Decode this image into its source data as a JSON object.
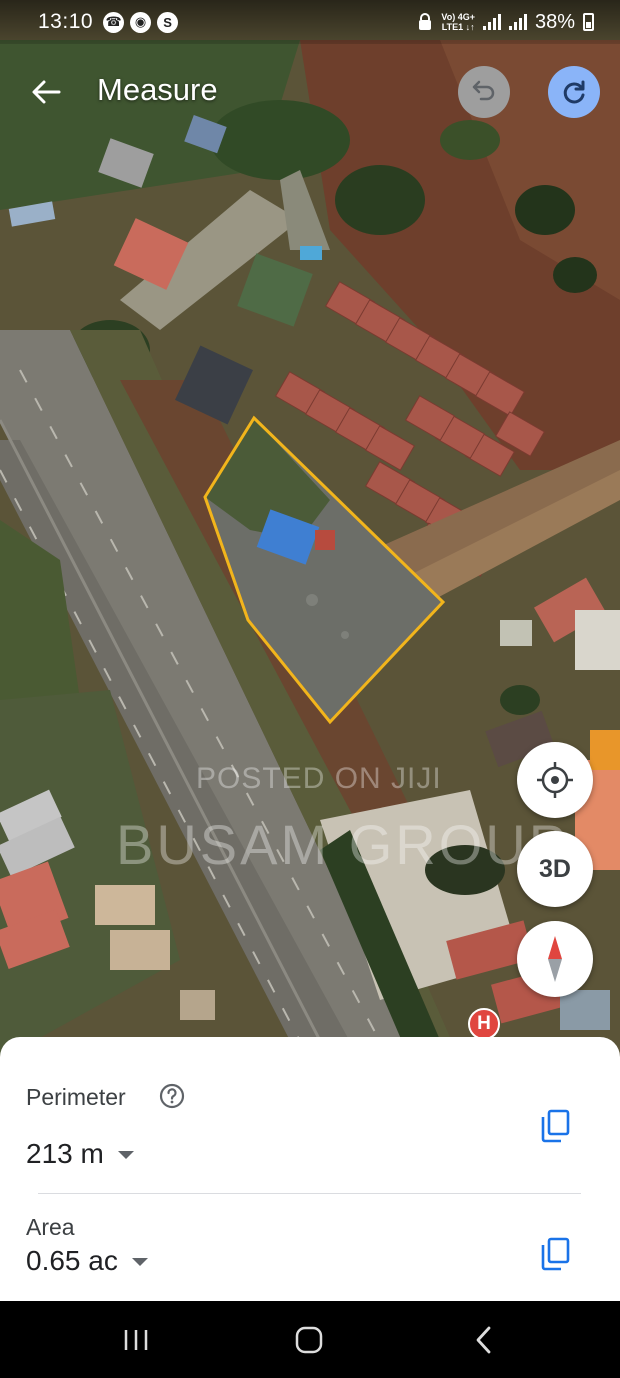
{
  "status_bar": {
    "time": "13:10",
    "network_line1": "Vo) 4G+",
    "network_line2": "LTE1 ↓↑",
    "battery": "38%",
    "left_icons": [
      "phone-icon",
      "instagram-icon",
      "shazam-icon"
    ],
    "right_icons": [
      "lock-icon",
      "signal-icon",
      "signal-icon",
      "battery-charging-icon"
    ]
  },
  "app_bar": {
    "title": "Measure",
    "back_icon": "arrow-back-icon",
    "undo_icon": "undo-icon",
    "redo_icon": "redo-icon"
  },
  "map": {
    "view": "satellite",
    "measurement_outline_color": "#f2b51c",
    "watermark_line1": "POSTED ON JIJI",
    "watermark_line2": "BUSAM GROUP",
    "poi_marker": "H"
  },
  "fabs": {
    "location_icon": "my-location-icon",
    "mode_3d_label": "3D",
    "compass_icon": "compass-icon"
  },
  "sheet": {
    "perimeter_label": "Perimeter",
    "perimeter_value": "213 m",
    "area_label": "Area",
    "area_value": "0.65 ac",
    "help_icon": "help-icon",
    "copy_icon": "copy-icon",
    "accent_color": "#1a73e8"
  },
  "nav_bar": {
    "buttons": [
      "recent-apps-icon",
      "home-icon",
      "back-icon"
    ]
  }
}
